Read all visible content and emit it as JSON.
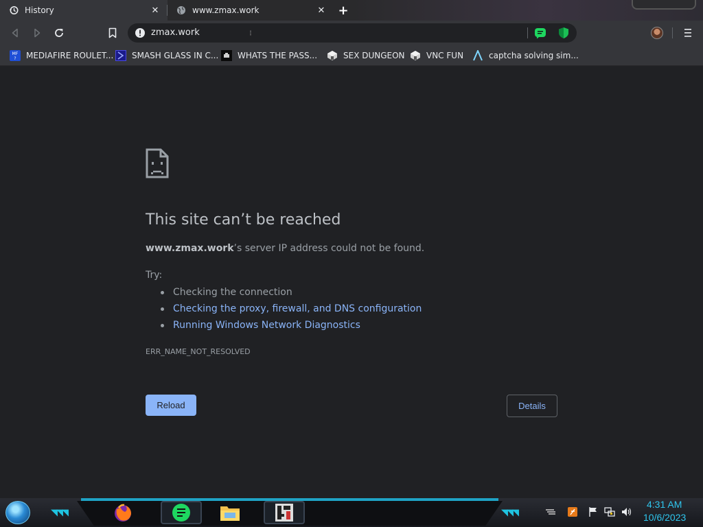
{
  "tabs": [
    {
      "title": "History",
      "icon": "history-icon"
    },
    {
      "title": "www.zmax.work",
      "icon": "globe-icon"
    }
  ],
  "tab_close": "✕",
  "new_tab": "+",
  "omnibox": {
    "url": "zmax.work",
    "security_icon": "info-icon"
  },
  "bookmarks": [
    {
      "label": "MEDIAFIRE ROULET...",
      "icon": "mediafire-icon"
    },
    {
      "label": "SMASH GLASS IN C...",
      "icon": "smash-icon"
    },
    {
      "label": "WHATS THE PASS...",
      "icon": "pass-icon"
    },
    {
      "label": "SEX DUNGEON",
      "icon": "dungeon-icon"
    },
    {
      "label": "VNC FUN",
      "icon": "vnc-icon"
    },
    {
      "label": "captcha solving sim...",
      "icon": "captcha-icon"
    }
  ],
  "error": {
    "title": "This site can’t be reached",
    "host": "www.zmax.work",
    "message_rest": "’s server IP address could not be found.",
    "try_label": "Try:",
    "suggestions": [
      "Checking the connection",
      "Checking the proxy, firewall, and DNS configuration",
      "Running Windows Network Diagnostics"
    ],
    "code": "ERR_NAME_NOT_RESOLVED",
    "reload_label": "Reload",
    "details_label": "Details"
  },
  "taskbar": {
    "time": "4:31 AM",
    "date": "10/6/2023",
    "apps": [
      "firefox-icon",
      "notes-app-icon",
      "file-explorer-icon",
      "game-app-icon"
    ]
  },
  "colors": {
    "page_bg": "#202124",
    "link": "#8ab4f8",
    "clock": "#2fc6ee"
  }
}
